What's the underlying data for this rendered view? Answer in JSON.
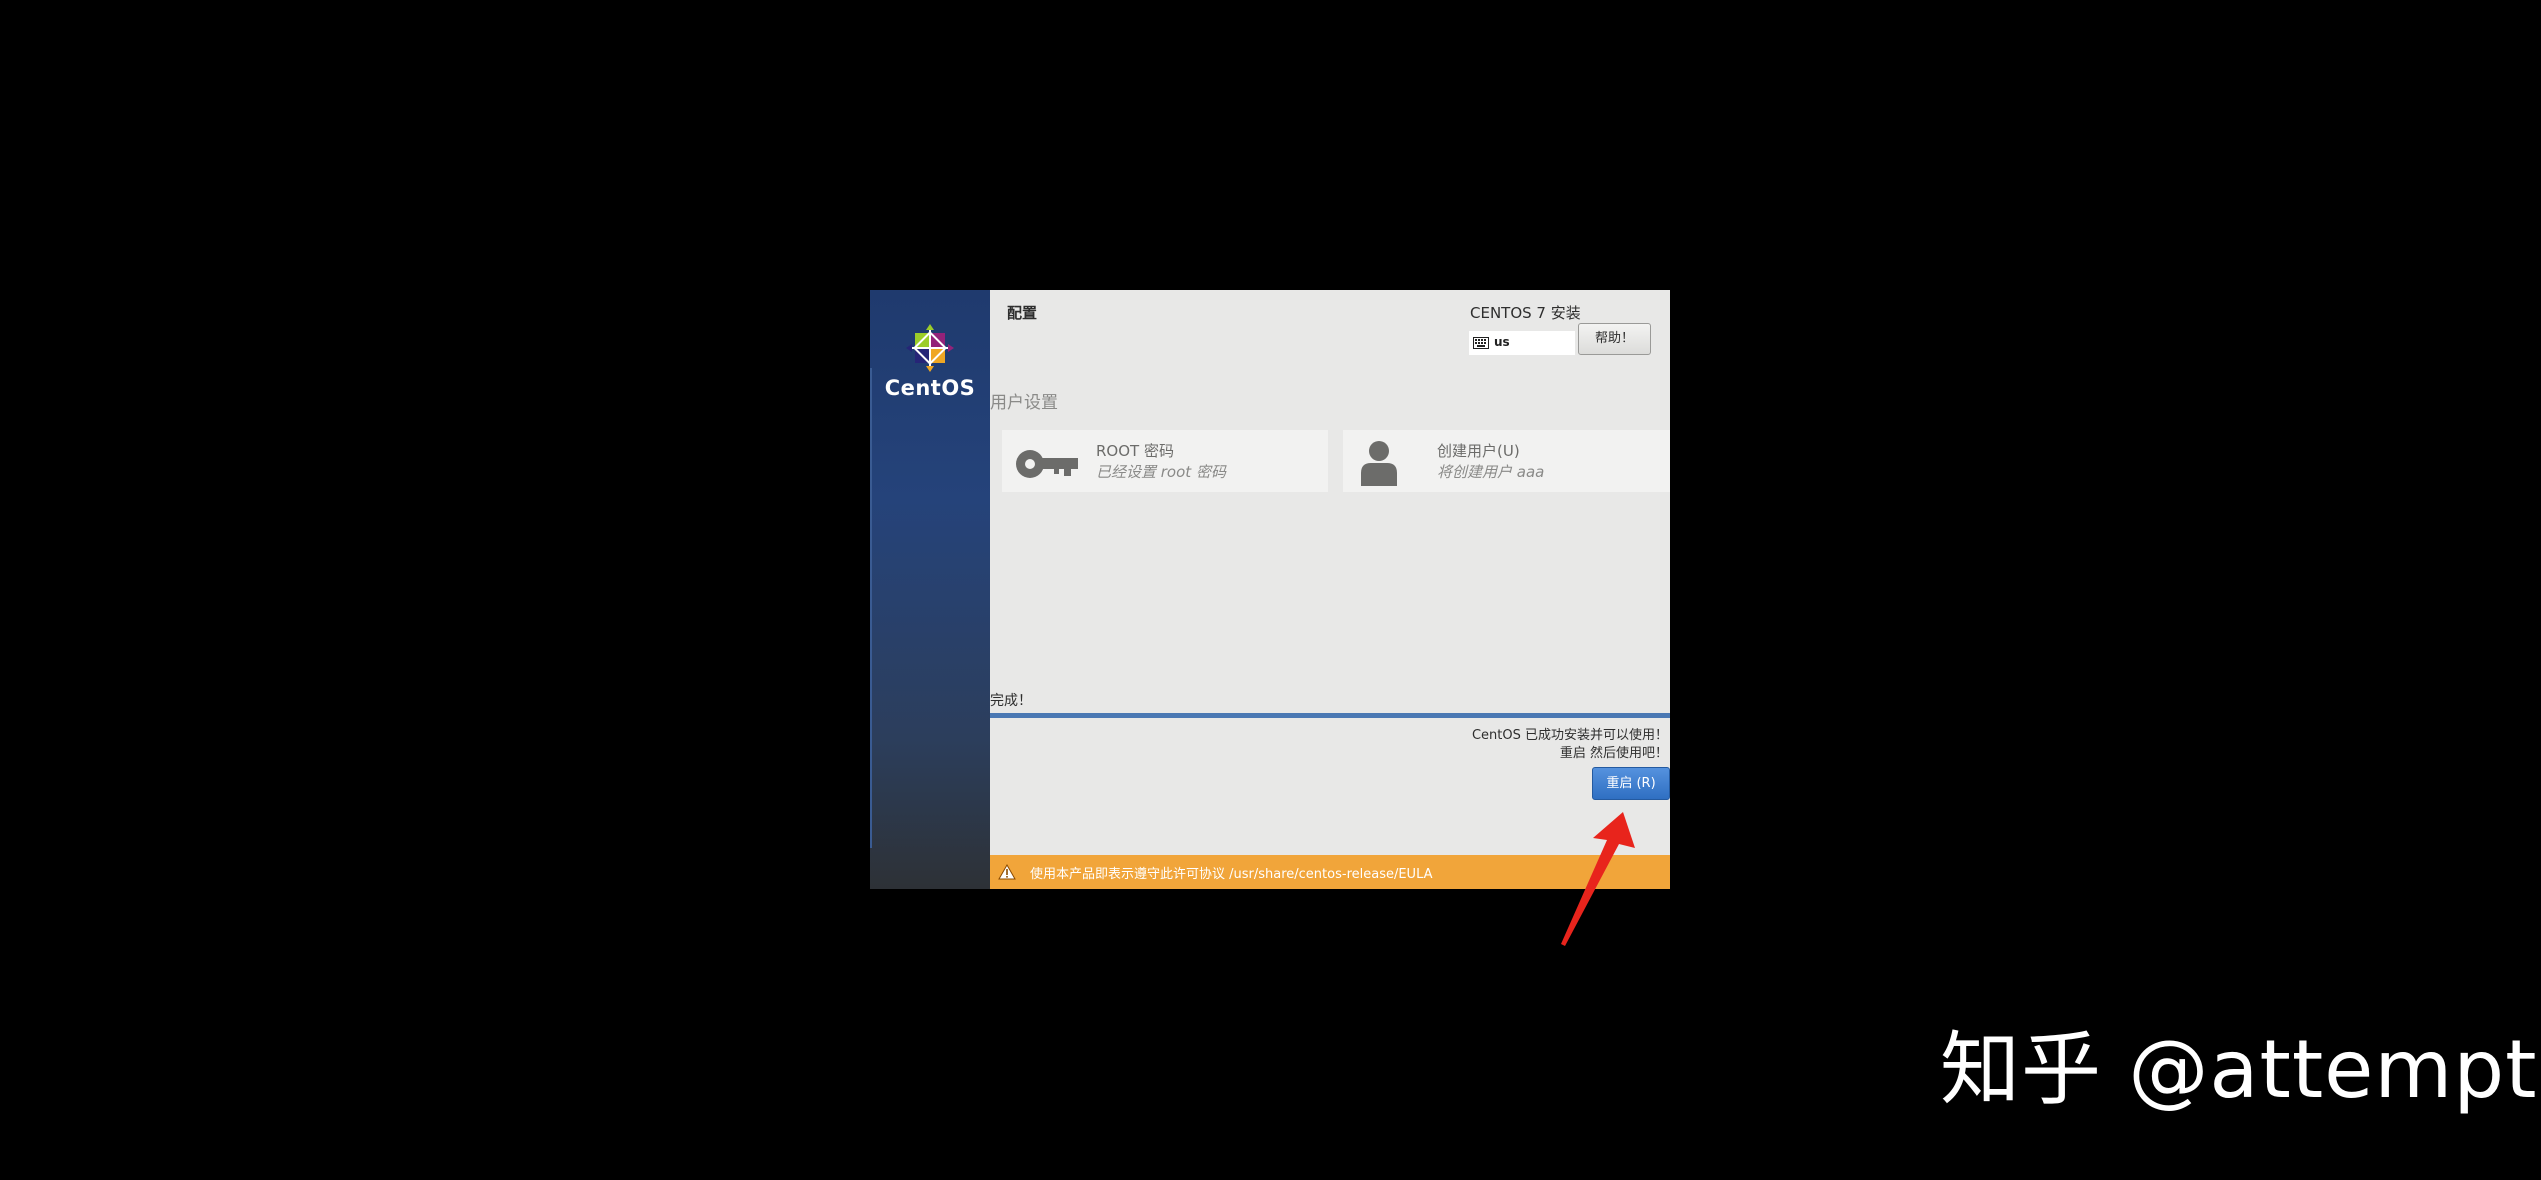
{
  "window": {
    "page_title": "配置",
    "product_title": "CENTOS 7 安装",
    "keyboard_layout": "us",
    "help_label": "帮助！"
  },
  "sidebar": {
    "brand": "CentOS"
  },
  "user_settings": {
    "section_label": "用户设置",
    "root_spoke": {
      "title": "ROOT 密码",
      "status": "已经设置 root 密码"
    },
    "user_spoke": {
      "title": "创建用户(U)",
      "status": "将创建用户 aaa"
    }
  },
  "progress": {
    "label": "完成！",
    "fraction": 1.0,
    "message_1": "CentOS 已成功安装并可以使用！",
    "message_2": "重启 然后使用吧！",
    "reboot_label": "重启 (R)"
  },
  "eula": {
    "text": "使用本产品即表示遵守此许可协议 /usr/share/centos-release/EULA"
  },
  "watermark": {
    "text": "知乎 @attempt"
  },
  "colors": {
    "sidebar_top": "#1f3a6e",
    "panel_bg": "#e8e8e7",
    "progress": "#3f6da8",
    "reboot_button": "#2f6fc2",
    "eula_bar": "#f1a53a",
    "annotation_arrow": "#e8241c"
  },
  "icons": {
    "logo": "centos-logo",
    "keyboard": "keyboard-icon",
    "root": "key-icon",
    "user": "user-icon",
    "warning": "warning-icon",
    "annotation": "red-arrow-icon"
  }
}
